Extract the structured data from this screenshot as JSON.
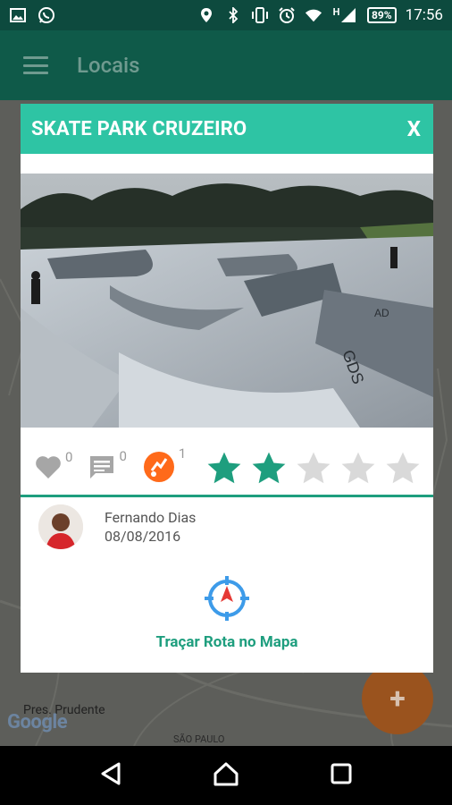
{
  "status_bar": {
    "battery": "89%",
    "time": "17:56",
    "network": "H",
    "icons": [
      "image-icon",
      "whatsapp-icon",
      "location-icon",
      "bluetooth-icon",
      "vibrate-icon",
      "alarm-icon",
      "wifi-icon",
      "signal-icon",
      "battery-icon"
    ]
  },
  "app_bar": {
    "title": "Locais",
    "menu_icon": "menu-icon"
  },
  "map": {
    "city_label": "Pres. Prudente",
    "region_label": "SÃO PAULO",
    "logo": "Google",
    "fab_label": "+"
  },
  "dialog": {
    "title": "SKATE PARK CRUZEIRO",
    "close_label": "X",
    "photo_description_icon": "skatepark-photo",
    "stats": {
      "likes": "0",
      "comments": "0",
      "checkins": "1"
    },
    "rating": {
      "value": 2,
      "max": 5
    },
    "author": {
      "name": "Fernando Dias",
      "date": "08/08/2016"
    },
    "route_label": "Traçar Rota no Mapa"
  },
  "colors": {
    "accent": "#2ec4a4",
    "accent_dark": "#1e9e7e",
    "app_bar": "#0f5a49",
    "star_on": "#1e9e7e",
    "star_off": "#d9d9d9",
    "fab": "#ff7f1f"
  }
}
